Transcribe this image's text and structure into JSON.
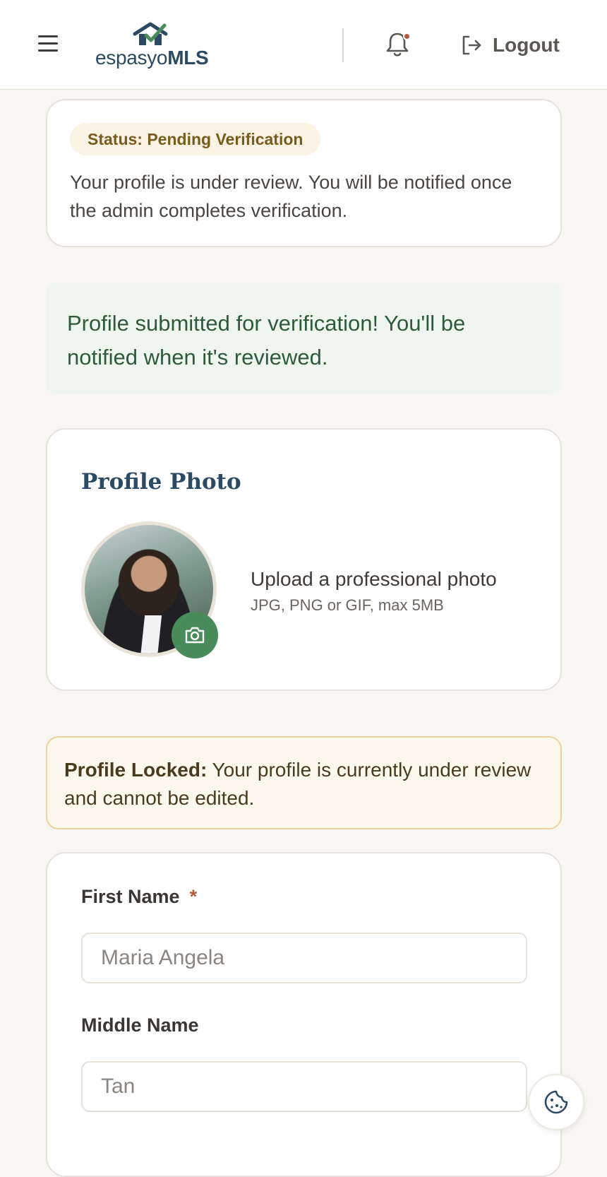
{
  "header": {
    "logo": {
      "text_regular": "espasyo",
      "text_bold": "MLS"
    },
    "notification_icon": "bell-icon",
    "logout_label": "Logout"
  },
  "status": {
    "pill": "Status: Pending Verification",
    "message": "Your profile is under review. You will be notified once the admin completes verification."
  },
  "success_alert": {
    "message": "Profile submitted for verification! You'll be notified when it's reviewed."
  },
  "profile_photo": {
    "title": "Profile Photo",
    "upload_title": "Upload a professional photo",
    "upload_hint": "JPG, PNG or GIF, max 5MB"
  },
  "lock_banner": {
    "title": "Profile Locked:",
    "message": " Your profile is currently under review and cannot be edited."
  },
  "form": {
    "first_name": {
      "label": "First Name",
      "required": "*",
      "value": "Maria Angela"
    },
    "middle_name": {
      "label": "Middle Name",
      "value": "Tan"
    }
  },
  "colors": {
    "brand_navy": "#2c4a63",
    "brand_green": "#4a8b5c",
    "accent_rust": "#b5583a",
    "warning_border": "#ecd39e"
  }
}
